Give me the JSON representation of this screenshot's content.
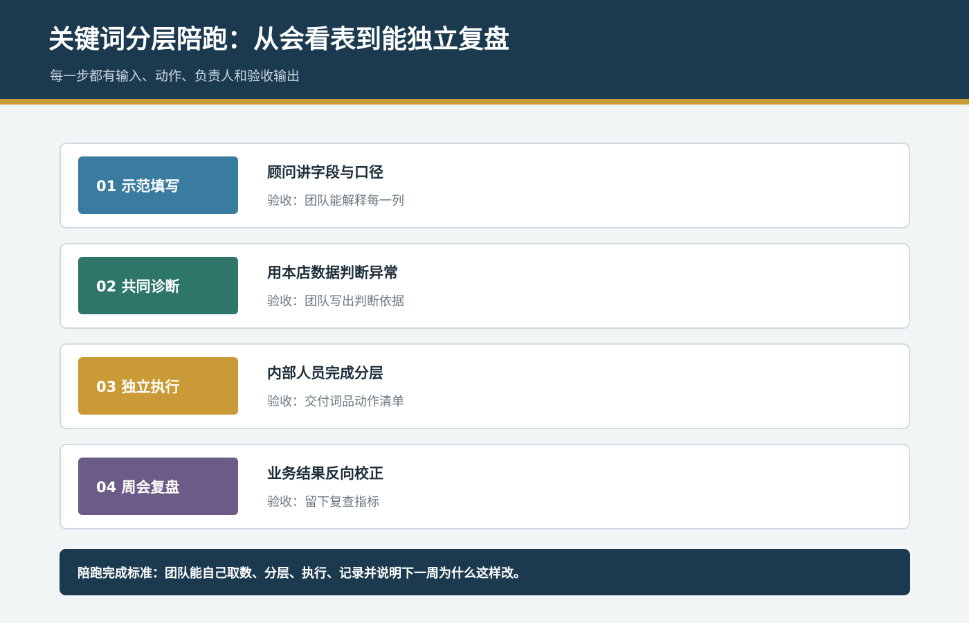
{
  "header": {
    "title": "关键词分层陪跑：从会看表到能独立复盘",
    "subtitle": "每一步都有输入、动作、负责人和验收输出"
  },
  "steps": [
    {
      "badge": "01 示范填写",
      "badge_color": "#3a7ba0",
      "title": "顾问讲字段与口径",
      "acceptance": "验收：团队能解释每一列"
    },
    {
      "badge": "02 共同诊断",
      "badge_color": "#2e7669",
      "title": "用本店数据判断异常",
      "acceptance": "验收：团队写出判断依据"
    },
    {
      "badge": "03 独立执行",
      "badge_color": "#c99a35",
      "title": "内部人员完成分层",
      "acceptance": "验收：交付词品动作清单"
    },
    {
      "badge": "04 周会复盘",
      "badge_color": "#6b5b86",
      "title": "业务结果反向校正",
      "acceptance": "验收：留下复查指标"
    }
  ],
  "footer": {
    "text": "陪跑完成标准：团队能自己取数、分层、执行、记录并说明下一周为什么这样改。"
  },
  "colors": {
    "header_bg": "#1b3a4f",
    "accent_stripe": "#c99a35",
    "page_bg": "#f2f5f6"
  }
}
